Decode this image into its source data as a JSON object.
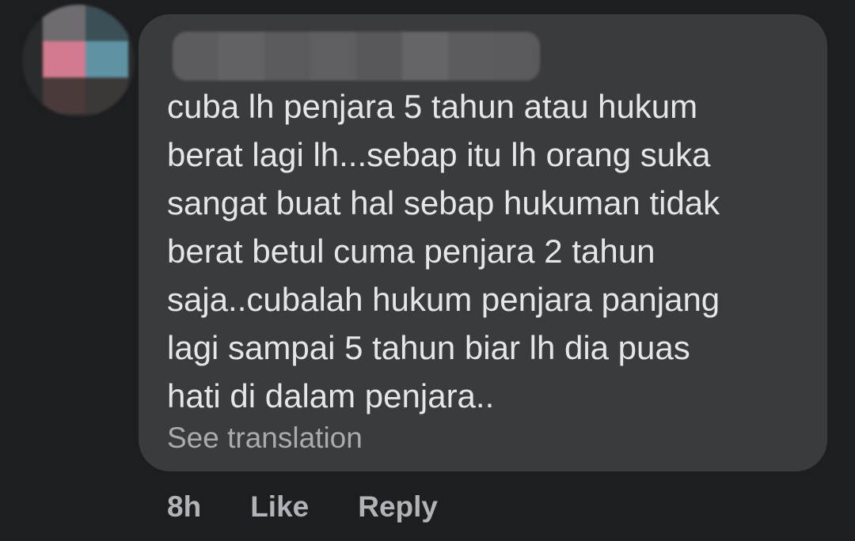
{
  "comment": {
    "author_name": "",
    "text_lines": [
      "cuba lh penjara 5 tahun atau hukum",
      "berat lagi lh...sebap itu lh orang suka",
      "sangat buat hal sebap hukuman tidak",
      "berat betul cuma penjara 2 tahun",
      "saja..cubalah hukum penjara panjang",
      "lagi sampai 5 tahun biar lh dia puas",
      "hati di dalam penjara.."
    ],
    "see_translation_label": "See translation"
  },
  "actions": {
    "timestamp": "8h",
    "like_label": "Like",
    "reply_label": "Reply"
  },
  "colors": {
    "background": "#1d1e20",
    "bubble": "#3a3b3d",
    "comment_text": "#e4e6ea",
    "secondary_text": "#a8abaf",
    "action_text": "#b0b3b8"
  }
}
